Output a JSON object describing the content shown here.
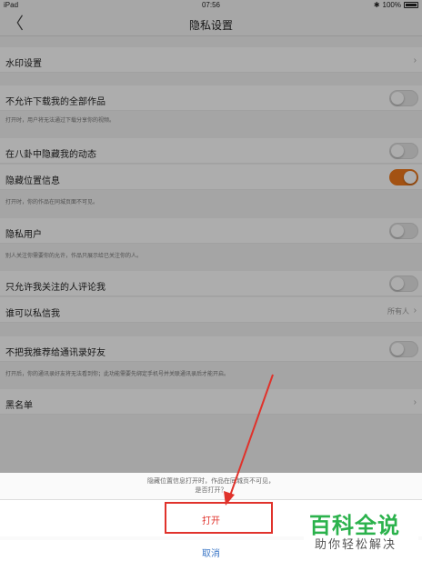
{
  "status_bar": {
    "device": "iPad",
    "time": "07:56",
    "battery": "100%"
  },
  "nav": {
    "title": "隐私设置",
    "back_glyph": "〈"
  },
  "rows": {
    "watermark": {
      "label": "水印设置"
    },
    "no_download": {
      "label": "不允许下载我的全部作品",
      "hint": "打开时，用户将无法通过下载分享你的视频。",
      "on": false
    },
    "hide_gossip": {
      "label": "在八卦中隐藏我的动态",
      "on": false
    },
    "hide_location": {
      "label": "隐藏位置信息",
      "hint": "打开时，你的作品在同城页面不可见。",
      "on": true
    },
    "private_user": {
      "label": "隐私用户",
      "hint": "别人关注你需要你的允许，作品只展示给已关注你的人。",
      "on": false
    },
    "only_followed_comment": {
      "label": "只允许我关注的人评论我",
      "on": false
    },
    "who_can_dm": {
      "label": "谁可以私信我",
      "value": "所有人"
    },
    "no_recommend_contacts": {
      "label": "不把我推荐给通讯录好友",
      "hint": "打开后，你的通讯录好友将无法看到你；此功能需要先绑定手机号并关联通讯录后才能开启。",
      "on": false
    },
    "blacklist": {
      "label": "黑名单"
    }
  },
  "sheet": {
    "message_line1": "隐藏位置信息打开时，作品在同城页不可见，",
    "message_line2": "是否打开？",
    "open_label": "打开",
    "cancel_label": "取消"
  },
  "watermark_logo": {
    "title": "百科全说",
    "subtitle": "助你轻松解决"
  },
  "colors": {
    "accent": "#f07a1c",
    "highlight": "#e0322b",
    "cancel": "#3a76c6",
    "logo": "#2bb24c"
  }
}
